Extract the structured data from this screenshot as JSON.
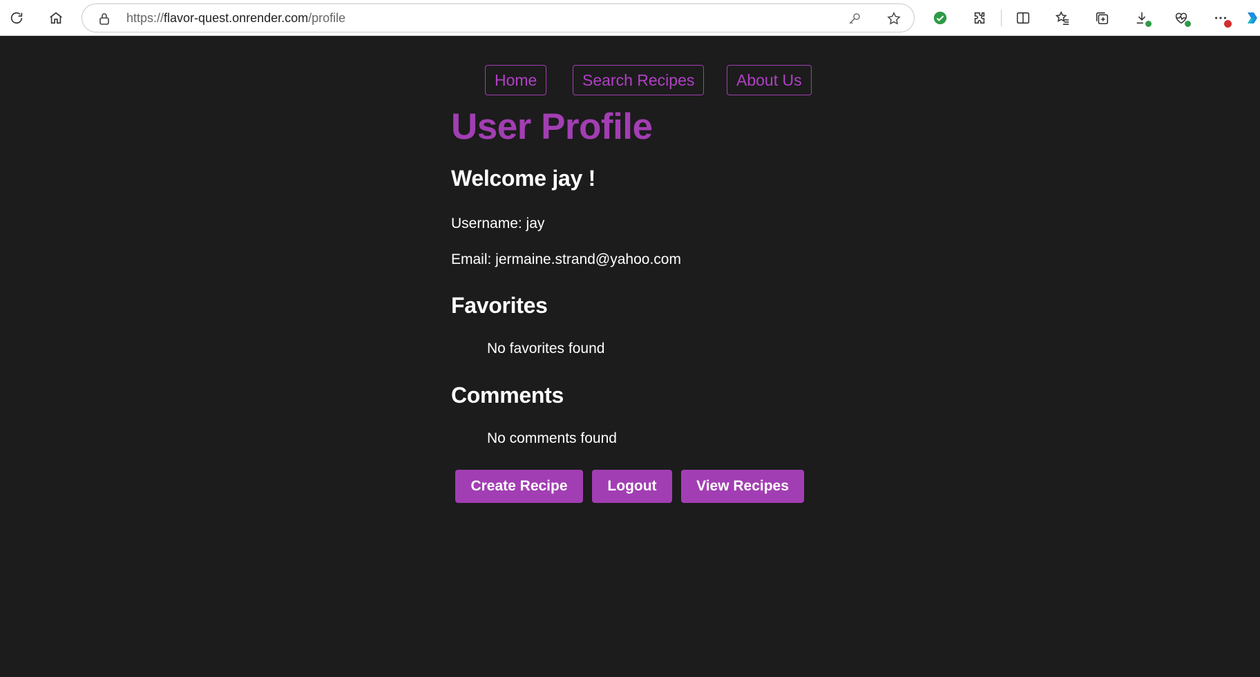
{
  "browser": {
    "url_prefix": "https://",
    "url_host": "flavor-quest.onrender.com",
    "url_path": "/profile",
    "icons": [
      "refresh-icon",
      "home-icon",
      "lock-icon",
      "key-icon",
      "star-icon",
      "shield-check-icon",
      "extensions-icon",
      "split-screen-icon",
      "favorites-icon",
      "collections-icon",
      "downloads-icon",
      "health-icon",
      "more-icon",
      "copilot-icon"
    ],
    "accent_green": "#2e9b47",
    "notification_red": "#d32f2f"
  },
  "nav": {
    "home": "Home",
    "search": "Search Recipes",
    "about": "About Us"
  },
  "profile": {
    "title": "User Profile",
    "welcome": "Welcome jay !",
    "username_line": "Username: jay",
    "email_line": "Email: jermaine.strand@yahoo.com"
  },
  "favorites": {
    "heading": "Favorites",
    "empty": "No favorites found"
  },
  "comments": {
    "heading": "Comments",
    "empty": "No comments found"
  },
  "actions": {
    "create": "Create Recipe",
    "logout": "Logout",
    "view": "View Recipes"
  },
  "colors": {
    "accent": "#a23eb3",
    "background": "#1c1c1c",
    "text": "#ffffff"
  }
}
